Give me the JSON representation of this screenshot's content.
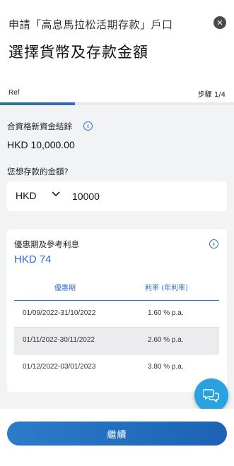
{
  "header": {
    "subtitle": "申請「高息馬拉松活期存款」戶口",
    "title": "選擇貨幣及存款金額",
    "ref_label": "Ref",
    "step_text": "步驟 1/4",
    "progress": 0.32,
    "close_icon": "close-icon"
  },
  "balance": {
    "label": "合資格新資金結餘",
    "value": "HKD 10,000.00"
  },
  "deposit": {
    "label": "您想存款的金額?",
    "currency": "HKD",
    "amount": "10000"
  },
  "rates": {
    "title": "優惠期及參考利息",
    "interest": "HKD 74",
    "columns": [
      "優惠期",
      "利率 (年利率)"
    ],
    "rows": [
      {
        "period": "01/09/2022-31/10/2022",
        "rate": "1.60 % p.a."
      },
      {
        "period": "01/11/2022-30/11/2022",
        "rate": "2.60 % p.a."
      },
      {
        "period": "01/12/2022-03/01/2023",
        "rate": "3.80 % p.a."
      }
    ]
  },
  "footer": {
    "continue_label": "繼續"
  },
  "colors": {
    "accent": "#2f6cc6",
    "button": "#1d62b5",
    "chat": "#29a3e0",
    "background": "#f2f3f5"
  }
}
